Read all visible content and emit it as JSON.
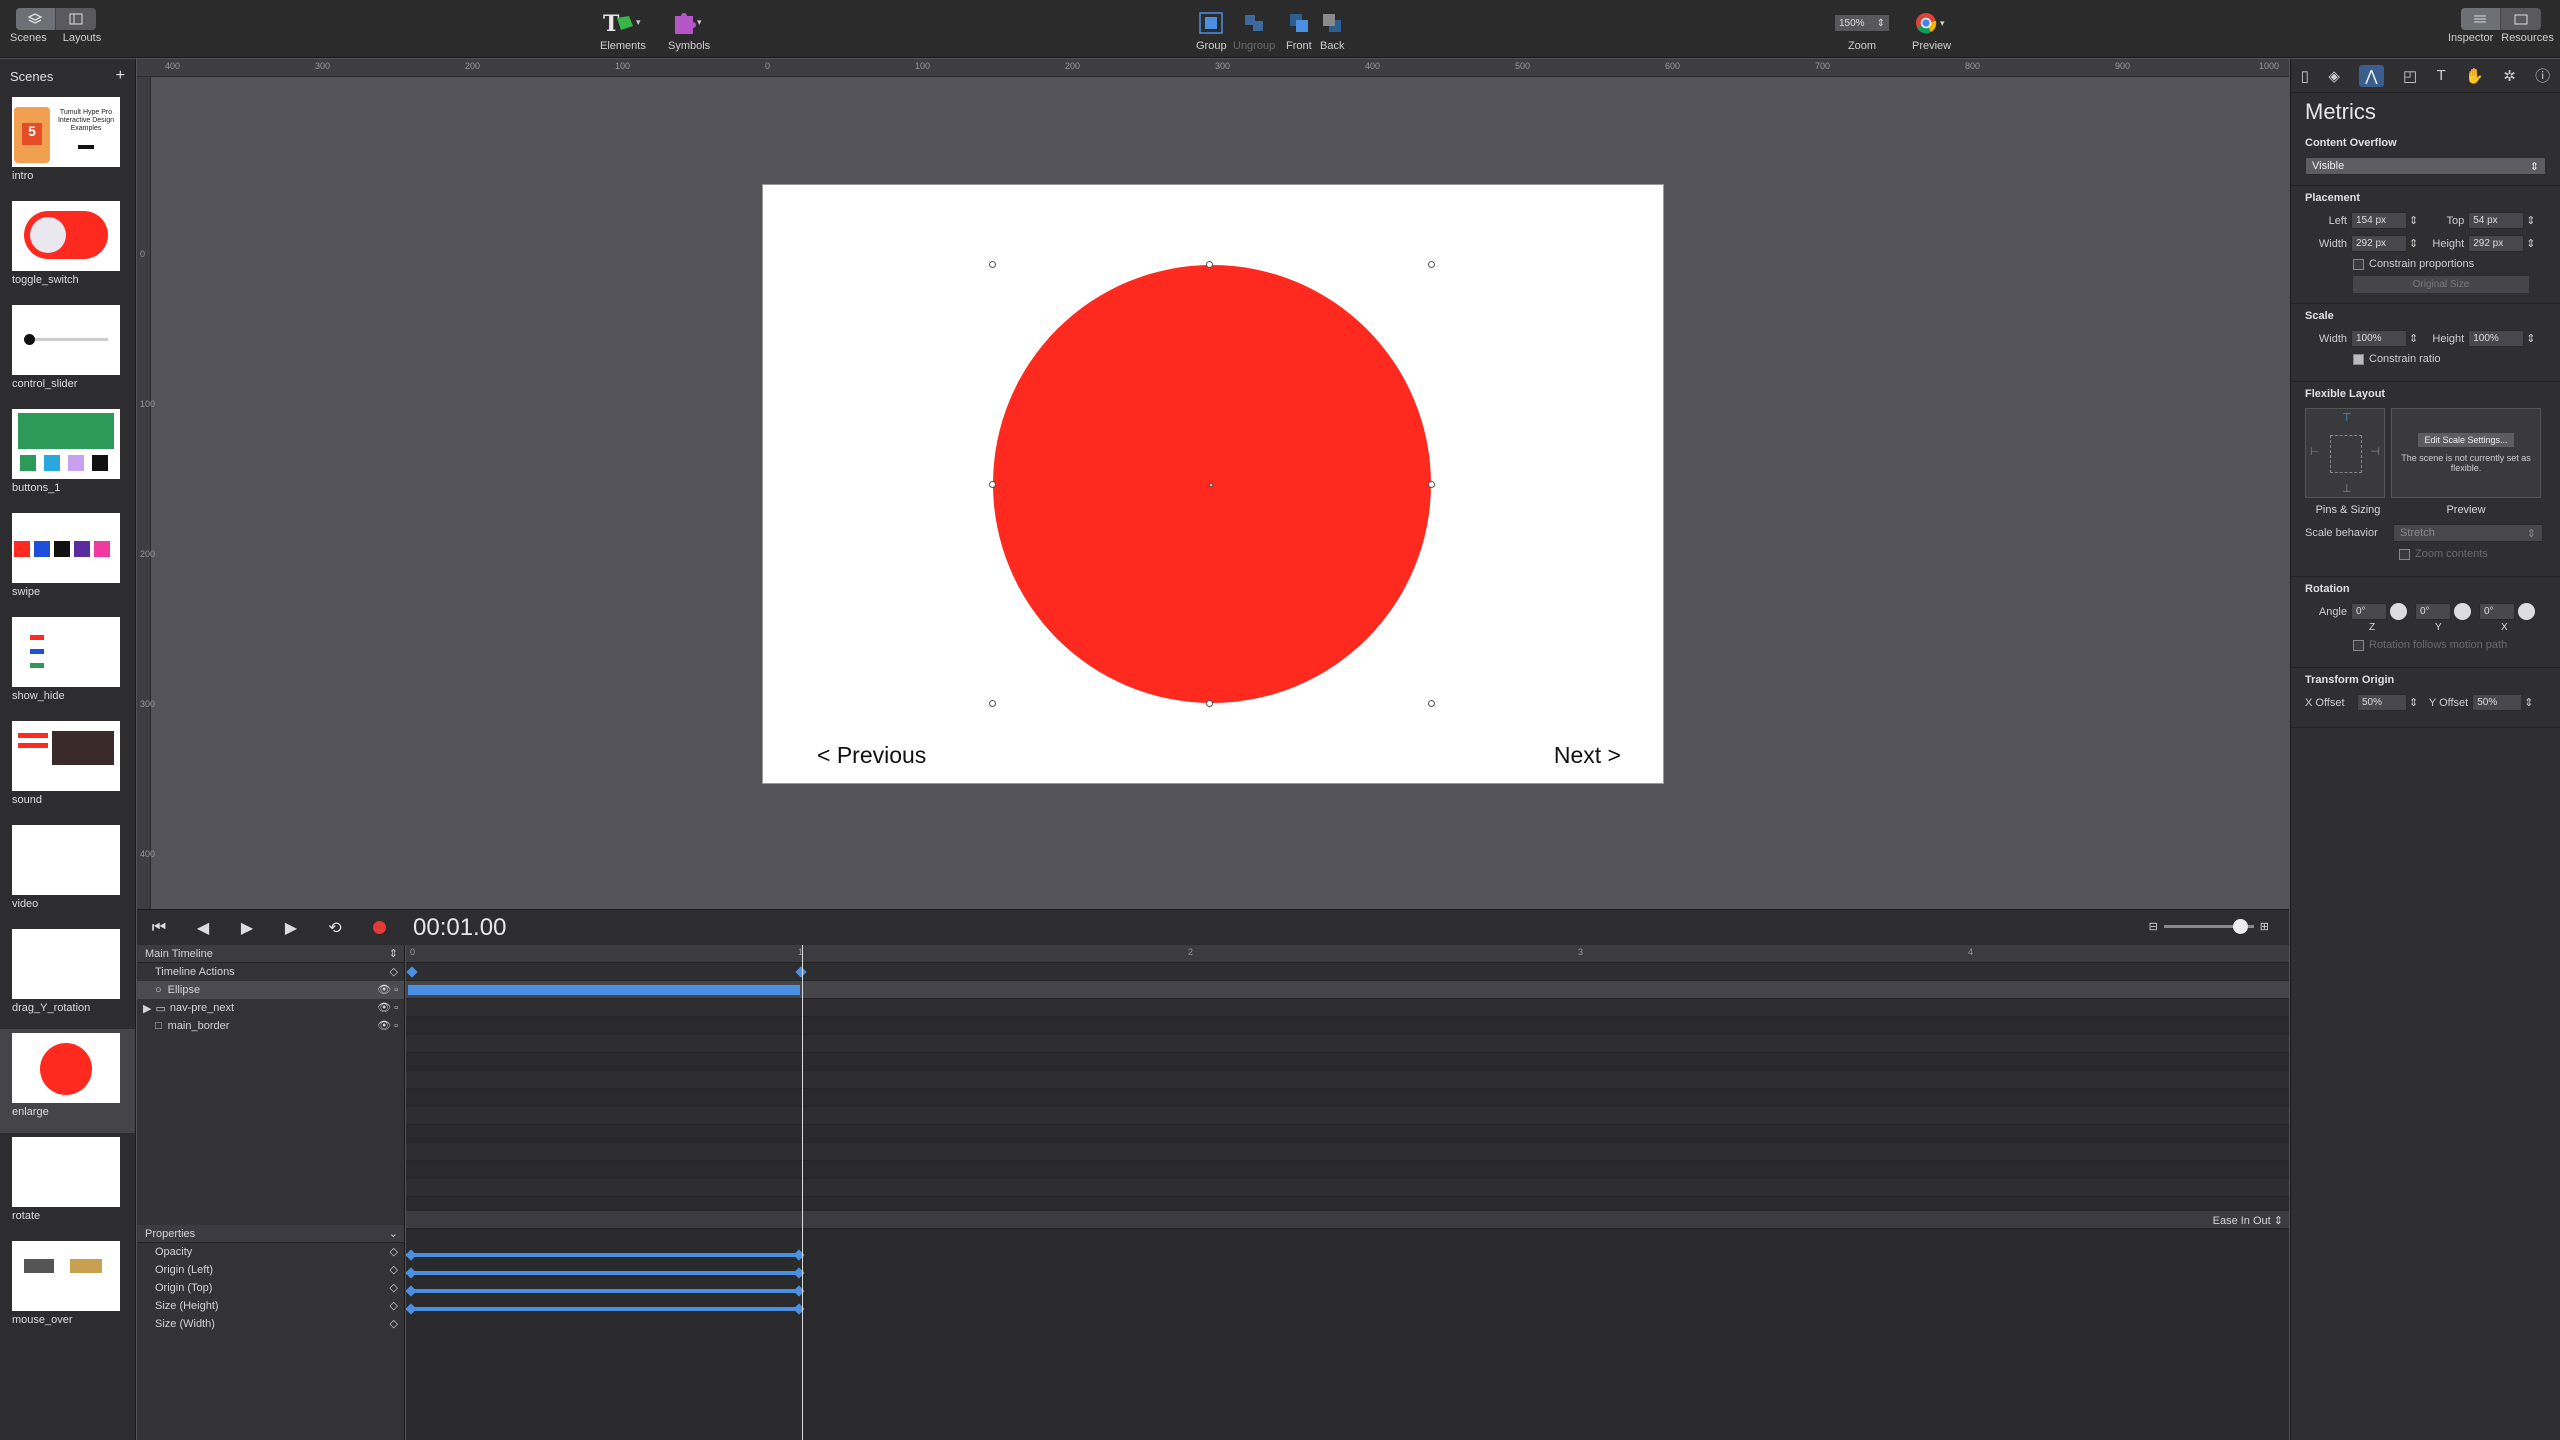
{
  "toolbar": {
    "scenes_label": "Scenes",
    "layouts_label": "Layouts",
    "elements_label": "Elements",
    "symbols_label": "Symbols",
    "group_label": "Group",
    "ungroup_label": "Ungroup",
    "front_label": "Front",
    "back_label": "Back",
    "zoom_value": "150%",
    "zoom_label": "Zoom",
    "preview_label": "Preview",
    "inspector_label": "Inspector",
    "resources_label": "Resources"
  },
  "scenes_panel": {
    "title": "Scenes",
    "add": "+",
    "scenes": [
      {
        "name": "intro",
        "thumb_text": "Tumult Hype Pro Interactive Design Examples"
      },
      {
        "name": "toggle_switch"
      },
      {
        "name": "control_slider"
      },
      {
        "name": "buttons_1"
      },
      {
        "name": "swipe"
      },
      {
        "name": "show_hide"
      },
      {
        "name": "sound"
      },
      {
        "name": "video"
      },
      {
        "name": "drag_Y_rotation"
      },
      {
        "name": "enlarge"
      },
      {
        "name": "rotate"
      },
      {
        "name": "mouse_over"
      }
    ]
  },
  "ruler": {
    "top_ticks": [
      "400",
      "300",
      "200",
      "100",
      "0",
      "100",
      "200",
      "300",
      "400",
      "500",
      "600",
      "700",
      "800",
      "900",
      "1000"
    ],
    "left_ticks": [
      "0",
      "100",
      "200",
      "300",
      "400"
    ]
  },
  "stage": {
    "prev_text": "< Previous",
    "next_text": "Next >",
    "circle_color": "#fe2a1f"
  },
  "transport": {
    "timecode": "00:01.00"
  },
  "timeline": {
    "main_timeline": "Main Timeline",
    "rows": [
      "Timeline Actions",
      "Ellipse",
      "nav-pre_next",
      "main_border"
    ],
    "ticks": [
      "0",
      "1",
      "2",
      "3",
      "4"
    ],
    "properties_label": "Properties",
    "easing": "Ease In Out",
    "properties": [
      "Opacity",
      "Origin (Left)",
      "Origin (Top)",
      "Size (Height)",
      "Size (Width)"
    ]
  },
  "inspector": {
    "title": "Metrics",
    "content_overflow_label": "Content Overflow",
    "content_overflow_value": "Visible",
    "placement_label": "Placement",
    "left_label": "Left",
    "left_value": "154 px",
    "top_label": "Top",
    "top_value": "54 px",
    "width_label": "Width",
    "width_value": "292 px",
    "height_label": "Height",
    "height_value": "292 px",
    "constrain_proportions": "Constrain proportions",
    "original_size": "Original Size",
    "scale_label": "Scale",
    "scale_width_value": "100%",
    "scale_height_value": "100%",
    "constrain_ratio": "Constrain ratio",
    "flexible_layout_label": "Flexible Layout",
    "edit_scale_settings": "Edit Scale Settings...",
    "not_flexible": "The scene is not currently set as flexible.",
    "pins_sizing": "Pins & Sizing",
    "preview": "Preview",
    "scale_behavior_label": "Scale behavior",
    "scale_behavior_value": "Stretch",
    "zoom_contents": "Zoom contents",
    "rotation_label": "Rotation",
    "angle_label": "Angle",
    "angle_z": "0°",
    "angle_y": "0°",
    "angle_x": "0°",
    "axis_z": "Z",
    "axis_y": "Y",
    "axis_x": "X",
    "rotation_follows": "Rotation follows motion path",
    "transform_origin_label": "Transform Origin",
    "x_offset_label": "X Offset",
    "x_offset_value": "50%",
    "y_offset_label": "Y Offset",
    "y_offset_value": "50%"
  }
}
